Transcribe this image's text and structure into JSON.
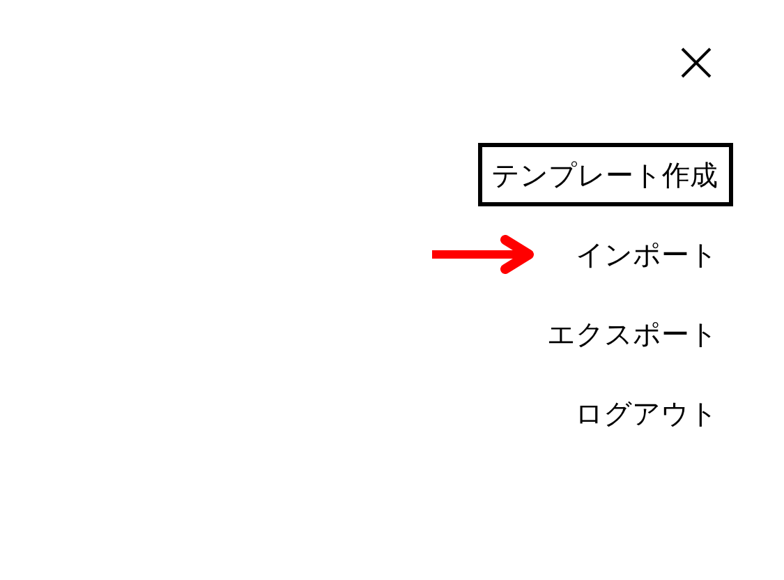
{
  "menu": {
    "items": [
      {
        "label": "テンプレート作成",
        "selected": true,
        "arrow": false
      },
      {
        "label": "インポート",
        "selected": false,
        "arrow": true
      },
      {
        "label": "エクスポート",
        "selected": false,
        "arrow": false
      },
      {
        "label": "ログアウト",
        "selected": false,
        "arrow": false
      }
    ]
  }
}
